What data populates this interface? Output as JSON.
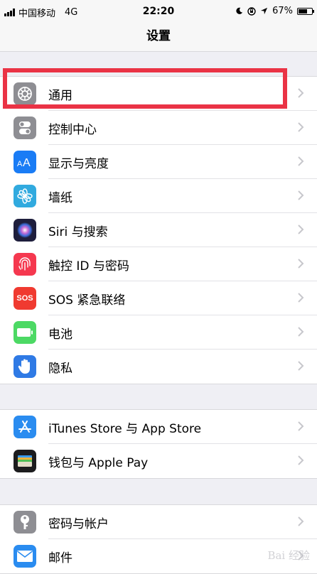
{
  "status_bar": {
    "carrier": "中国移动",
    "network": "4G",
    "time": "22:20",
    "battery_percent": "67%",
    "battery_level": 0.67
  },
  "nav": {
    "title": "设置"
  },
  "groups": [
    {
      "rows": [
        {
          "label": "通用",
          "icon": "gear-icon",
          "color": "#8e8e93"
        },
        {
          "label": "控制中心",
          "icon": "toggles-icon",
          "color": "#8e8e93"
        },
        {
          "label": "显示与亮度",
          "icon": "text-size-icon",
          "color": "#1a7cf5"
        },
        {
          "label": "墙纸",
          "icon": "flower-icon",
          "color": "#31aadf"
        },
        {
          "label": "Siri 与搜索",
          "icon": "siri-icon",
          "color": "#1e1e3c"
        },
        {
          "label": "触控 ID 与密码",
          "icon": "fingerprint-icon",
          "color": "#f5384f"
        },
        {
          "label": "SOS 紧急联络",
          "icon": "sos-icon",
          "color": "#f03a30",
          "icon_text": "SOS"
        },
        {
          "label": "电池",
          "icon": "battery-icon",
          "color": "#4cd964"
        },
        {
          "label": "隐私",
          "icon": "hand-icon",
          "color": "#2f7ae5"
        }
      ]
    },
    {
      "rows": [
        {
          "label": "iTunes Store 与 App Store",
          "icon": "app-store-icon",
          "color": "#2a8cf0"
        },
        {
          "label": "钱包与 Apple Pay",
          "icon": "wallet-icon",
          "color": "#1c1c1e"
        }
      ]
    },
    {
      "rows": [
        {
          "label": "密码与帐户",
          "icon": "key-icon",
          "color": "#8e8e93"
        },
        {
          "label": "邮件",
          "icon": "mail-icon",
          "color": "#2a8cf0"
        }
      ]
    }
  ],
  "watermark": "Bai 经验"
}
